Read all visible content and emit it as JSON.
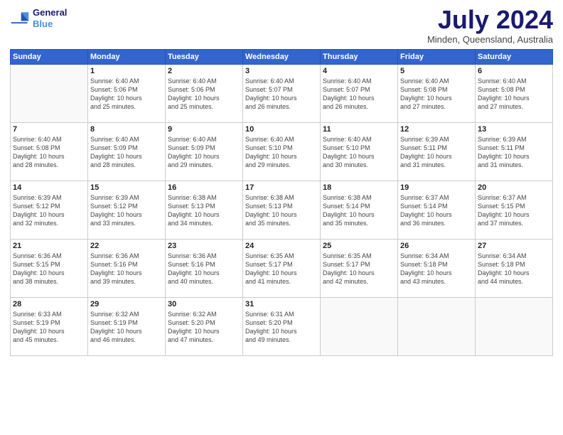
{
  "header": {
    "logo_line1": "General",
    "logo_line2": "Blue",
    "month": "July 2024",
    "location": "Minden, Queensland, Australia"
  },
  "days_of_week": [
    "Sunday",
    "Monday",
    "Tuesday",
    "Wednesday",
    "Thursday",
    "Friday",
    "Saturday"
  ],
  "weeks": [
    [
      {
        "day": "",
        "info": ""
      },
      {
        "day": "1",
        "info": "Sunrise: 6:40 AM\nSunset: 5:06 PM\nDaylight: 10 hours\nand 25 minutes."
      },
      {
        "day": "2",
        "info": "Sunrise: 6:40 AM\nSunset: 5:06 PM\nDaylight: 10 hours\nand 25 minutes."
      },
      {
        "day": "3",
        "info": "Sunrise: 6:40 AM\nSunset: 5:07 PM\nDaylight: 10 hours\nand 26 minutes."
      },
      {
        "day": "4",
        "info": "Sunrise: 6:40 AM\nSunset: 5:07 PM\nDaylight: 10 hours\nand 26 minutes."
      },
      {
        "day": "5",
        "info": "Sunrise: 6:40 AM\nSunset: 5:08 PM\nDaylight: 10 hours\nand 27 minutes."
      },
      {
        "day": "6",
        "info": "Sunrise: 6:40 AM\nSunset: 5:08 PM\nDaylight: 10 hours\nand 27 minutes."
      }
    ],
    [
      {
        "day": "7",
        "info": "Sunrise: 6:40 AM\nSunset: 5:08 PM\nDaylight: 10 hours\nand 28 minutes."
      },
      {
        "day": "8",
        "info": "Sunrise: 6:40 AM\nSunset: 5:09 PM\nDaylight: 10 hours\nand 28 minutes."
      },
      {
        "day": "9",
        "info": "Sunrise: 6:40 AM\nSunset: 5:09 PM\nDaylight: 10 hours\nand 29 minutes."
      },
      {
        "day": "10",
        "info": "Sunrise: 6:40 AM\nSunset: 5:10 PM\nDaylight: 10 hours\nand 29 minutes."
      },
      {
        "day": "11",
        "info": "Sunrise: 6:40 AM\nSunset: 5:10 PM\nDaylight: 10 hours\nand 30 minutes."
      },
      {
        "day": "12",
        "info": "Sunrise: 6:39 AM\nSunset: 5:11 PM\nDaylight: 10 hours\nand 31 minutes."
      },
      {
        "day": "13",
        "info": "Sunrise: 6:39 AM\nSunset: 5:11 PM\nDaylight: 10 hours\nand 31 minutes."
      }
    ],
    [
      {
        "day": "14",
        "info": "Sunrise: 6:39 AM\nSunset: 5:12 PM\nDaylight: 10 hours\nand 32 minutes."
      },
      {
        "day": "15",
        "info": "Sunrise: 6:39 AM\nSunset: 5:12 PM\nDaylight: 10 hours\nand 33 minutes."
      },
      {
        "day": "16",
        "info": "Sunrise: 6:38 AM\nSunset: 5:13 PM\nDaylight: 10 hours\nand 34 minutes."
      },
      {
        "day": "17",
        "info": "Sunrise: 6:38 AM\nSunset: 5:13 PM\nDaylight: 10 hours\nand 35 minutes."
      },
      {
        "day": "18",
        "info": "Sunrise: 6:38 AM\nSunset: 5:14 PM\nDaylight: 10 hours\nand 35 minutes."
      },
      {
        "day": "19",
        "info": "Sunrise: 6:37 AM\nSunset: 5:14 PM\nDaylight: 10 hours\nand 36 minutes."
      },
      {
        "day": "20",
        "info": "Sunrise: 6:37 AM\nSunset: 5:15 PM\nDaylight: 10 hours\nand 37 minutes."
      }
    ],
    [
      {
        "day": "21",
        "info": "Sunrise: 6:36 AM\nSunset: 5:15 PM\nDaylight: 10 hours\nand 38 minutes."
      },
      {
        "day": "22",
        "info": "Sunrise: 6:36 AM\nSunset: 5:16 PM\nDaylight: 10 hours\nand 39 minutes."
      },
      {
        "day": "23",
        "info": "Sunrise: 6:36 AM\nSunset: 5:16 PM\nDaylight: 10 hours\nand 40 minutes."
      },
      {
        "day": "24",
        "info": "Sunrise: 6:35 AM\nSunset: 5:17 PM\nDaylight: 10 hours\nand 41 minutes."
      },
      {
        "day": "25",
        "info": "Sunrise: 6:35 AM\nSunset: 5:17 PM\nDaylight: 10 hours\nand 42 minutes."
      },
      {
        "day": "26",
        "info": "Sunrise: 6:34 AM\nSunset: 5:18 PM\nDaylight: 10 hours\nand 43 minutes."
      },
      {
        "day": "27",
        "info": "Sunrise: 6:34 AM\nSunset: 5:18 PM\nDaylight: 10 hours\nand 44 minutes."
      }
    ],
    [
      {
        "day": "28",
        "info": "Sunrise: 6:33 AM\nSunset: 5:19 PM\nDaylight: 10 hours\nand 45 minutes."
      },
      {
        "day": "29",
        "info": "Sunrise: 6:32 AM\nSunset: 5:19 PM\nDaylight: 10 hours\nand 46 minutes."
      },
      {
        "day": "30",
        "info": "Sunrise: 6:32 AM\nSunset: 5:20 PM\nDaylight: 10 hours\nand 47 minutes."
      },
      {
        "day": "31",
        "info": "Sunrise: 6:31 AM\nSunset: 5:20 PM\nDaylight: 10 hours\nand 49 minutes."
      },
      {
        "day": "",
        "info": ""
      },
      {
        "day": "",
        "info": ""
      },
      {
        "day": "",
        "info": ""
      }
    ]
  ]
}
